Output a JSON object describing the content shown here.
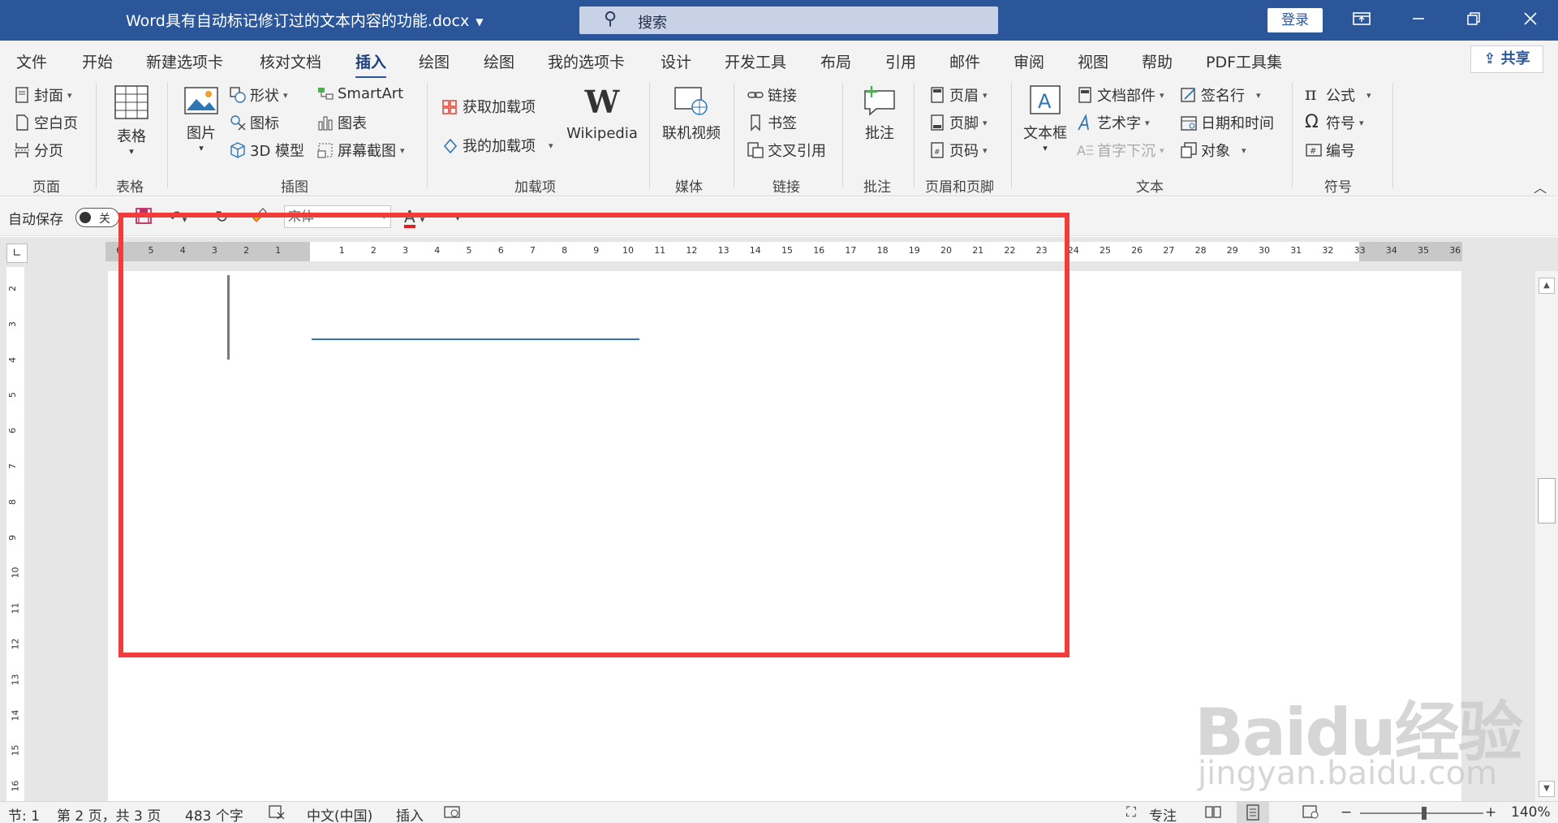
{
  "titlebar": {
    "doc_title": "Word具有自动标记修订过的文本内容的功能.docx",
    "search_placeholder": "搜索",
    "login": "登录"
  },
  "tabs": [
    "文件",
    "开始",
    "新建选项卡",
    "核对文档",
    "插入",
    "绘图",
    "绘图",
    "我的选项卡",
    "设计",
    "开发工具",
    "布局",
    "引用",
    "邮件",
    "审阅",
    "视图",
    "帮助",
    "PDF工具集"
  ],
  "active_tab": "插入",
  "share": "共享",
  "ribbon": {
    "page": {
      "items": [
        "封面",
        "空白页",
        "分页"
      ],
      "label": "页面"
    },
    "table": {
      "big": "表格",
      "label": "表格"
    },
    "illustrations": {
      "big": "图片",
      "items": [
        "形状",
        "图标",
        "3D 模型",
        "SmartArt",
        "图表",
        "屏幕截图"
      ],
      "label": "插图"
    },
    "addins": {
      "items": [
        "获取加载项",
        "我的加载项"
      ],
      "wikipedia": "Wikipedia",
      "label": "加载项"
    },
    "media": {
      "big": "联机视频",
      "label": "媒体"
    },
    "links": {
      "items": [
        "链接",
        "书签",
        "交叉引用"
      ],
      "label": "链接"
    },
    "comments": {
      "big": "批注",
      "label": "批注"
    },
    "header_footer": {
      "items": [
        "页眉",
        "页脚",
        "页码"
      ],
      "label": "页眉和页脚"
    },
    "text": {
      "big": "文本框",
      "items": [
        "文档部件",
        "艺术字",
        "首字下沉",
        "签名行",
        "日期和时间",
        "对象"
      ],
      "label": "文本"
    },
    "symbols": {
      "items": [
        "公式",
        "符号",
        "编号"
      ],
      "label": "符号"
    }
  },
  "qat": {
    "autosave": "自动保存",
    "toggle": "关",
    "font": "宋体",
    "font_color_icon": "font-color-icon"
  },
  "ruler": {
    "left_nums": [
      "6",
      "5",
      "4",
      "3",
      "2",
      "1"
    ],
    "right_nums": [
      "1",
      "2",
      "3",
      "4",
      "5",
      "6",
      "7",
      "8",
      "9",
      "10",
      "11",
      "12",
      "13",
      "14",
      "15",
      "16",
      "17",
      "18",
      "19",
      "20",
      "21",
      "22",
      "23",
      "24",
      "25",
      "26",
      "27",
      "28",
      "29",
      "30",
      "31",
      "32",
      "33",
      "34",
      "35",
      "36"
    ],
    "v_nums": [
      "2",
      "3",
      "4",
      "5",
      "6",
      "7",
      "8",
      "9",
      "10",
      "11",
      "12",
      "13",
      "14",
      "15",
      "16"
    ]
  },
  "watermark": {
    "brand": "Baidu经验",
    "url": "jingyan.baidu.com"
  },
  "status": {
    "section": "节: 1",
    "page": "第 2 页，共 3 页",
    "words": "483 个字",
    "language": "中文(中国)",
    "mode": "插入",
    "focus": "专注",
    "zoom": "140%"
  },
  "colors": {
    "brand": "#2b579a",
    "highlight": "#f23c3c",
    "blue_line": "#2e75b6"
  }
}
